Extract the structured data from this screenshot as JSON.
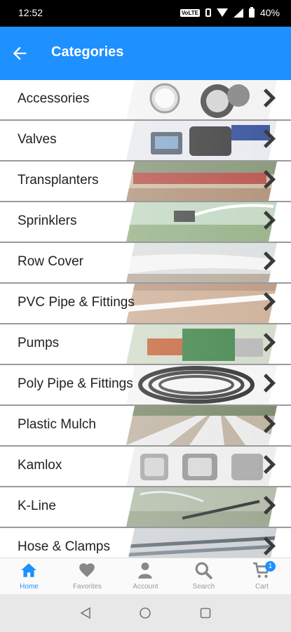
{
  "status_bar": {
    "time": "12:52",
    "volte": "VoLTE",
    "battery": "40%"
  },
  "app_bar": {
    "title": "Categories"
  },
  "categories": [
    {
      "label": "Accessories",
      "image": "gauges-photo"
    },
    {
      "label": "Valves",
      "image": "valves-photo"
    },
    {
      "label": "Transplanters",
      "image": "transplanters-photo"
    },
    {
      "label": "Sprinklers",
      "image": "sprinklers-photo"
    },
    {
      "label": "Row Cover",
      "image": "row-cover-photo"
    },
    {
      "label": "PVC Pipe & Fittings",
      "image": "pvc-pipe-photo"
    },
    {
      "label": "Pumps",
      "image": "pumps-photo"
    },
    {
      "label": "Poly Pipe & Fittings",
      "image": "poly-pipe-photo"
    },
    {
      "label": "Plastic Mulch",
      "image": "plastic-mulch-photo"
    },
    {
      "label": "Kamlox",
      "image": "kamlox-photo"
    },
    {
      "label": "K-Line",
      "image": "k-line-photo"
    },
    {
      "label": "Hose & Clamps",
      "image": "hose-clamps-photo"
    }
  ],
  "bottom_nav": {
    "items": [
      {
        "label": "Home",
        "icon": "home-icon",
        "active": true
      },
      {
        "label": "Favorites",
        "icon": "heart-icon",
        "active": false
      },
      {
        "label": "Account",
        "icon": "account-icon",
        "active": false
      },
      {
        "label": "Search",
        "icon": "search-icon",
        "active": false
      },
      {
        "label": "Cart",
        "icon": "cart-icon",
        "active": false
      }
    ],
    "cart_count": "1"
  },
  "colors": {
    "primary": "#1e90ff",
    "chevron": "#3a3a3a"
  }
}
